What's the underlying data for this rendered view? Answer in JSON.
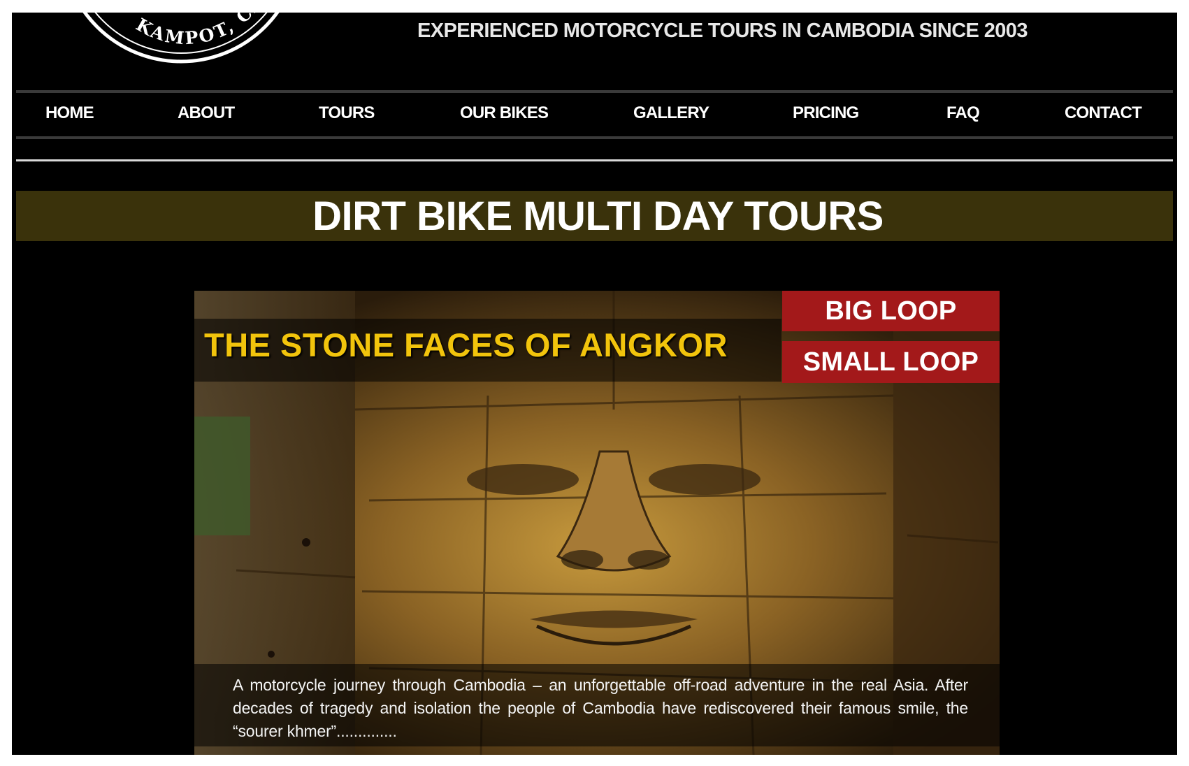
{
  "header": {
    "logo_text": "KAMPOT, CAMBO",
    "tagline": "EXPERIENCED MOTORCYCLE TOURS IN CAMBODIA SINCE 2003"
  },
  "nav": {
    "items": [
      {
        "label": "HOME"
      },
      {
        "label": "ABOUT"
      },
      {
        "label": "TOURS"
      },
      {
        "label": "OUR BIKES"
      },
      {
        "label": "GALLERY"
      },
      {
        "label": "PRICING"
      },
      {
        "label": "FAQ"
      },
      {
        "label": "CONTACT"
      }
    ]
  },
  "banner": {
    "title": "DIRT BIKE MULTI DAY TOURS"
  },
  "hero": {
    "title": "THE STONE FACES OF ANGKOR",
    "big_loop": "BIG LOOP",
    "small_loop": "SMALL LOOP",
    "description": "A motorcycle journey through Cambodia – an unforgettable off-road adventure in the real Asia. After decades of tragedy and isolation the people of Cambodia have rediscovered their famous smile, the “sourer khmer”.............."
  },
  "colors": {
    "background": "#000000",
    "banner_bg": "#3a320b",
    "hero_title": "#f2c40c",
    "loop_button": "#a3191a"
  }
}
